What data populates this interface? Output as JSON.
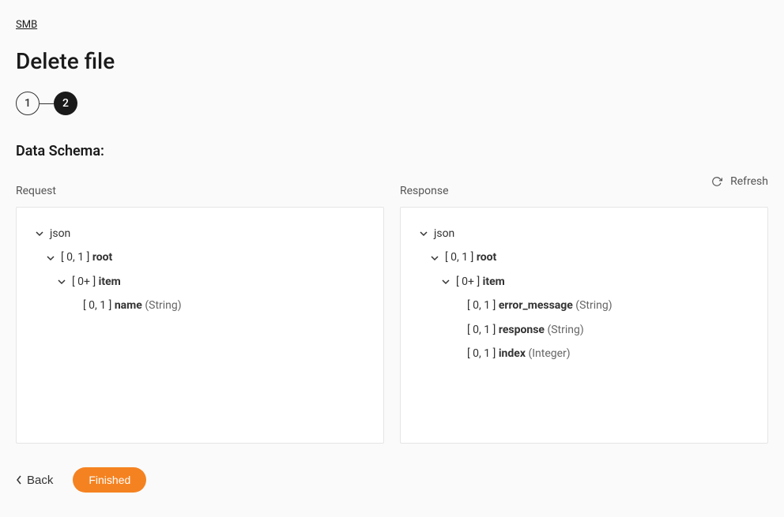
{
  "breadcrumb": "SMB",
  "page_title": "Delete file",
  "steps": {
    "one": "1",
    "two": "2"
  },
  "section_title": "Data Schema:",
  "refresh_label": "Refresh",
  "request_label": "Request",
  "response_label": "Response",
  "request_tree": {
    "json": "json",
    "root_card": "[ 0, 1 ]",
    "root_name": "root",
    "item_card": "[ 0+ ]",
    "item_name": "item",
    "name_card": "[ 0, 1 ]",
    "name_field": "name",
    "name_type": "(String)"
  },
  "response_tree": {
    "json": "json",
    "root_card": "[ 0, 1 ]",
    "root_name": "root",
    "item_card": "[ 0+ ]",
    "item_name": "item",
    "error_card": "[ 0, 1 ]",
    "error_field": "error_message",
    "error_type": "(String)",
    "resp_card": "[ 0, 1 ]",
    "resp_field": "response",
    "resp_type": "(String)",
    "index_card": "[ 0, 1 ]",
    "index_field": "index",
    "index_type": "(Integer)"
  },
  "back_label": "Back",
  "finished_label": "Finished"
}
